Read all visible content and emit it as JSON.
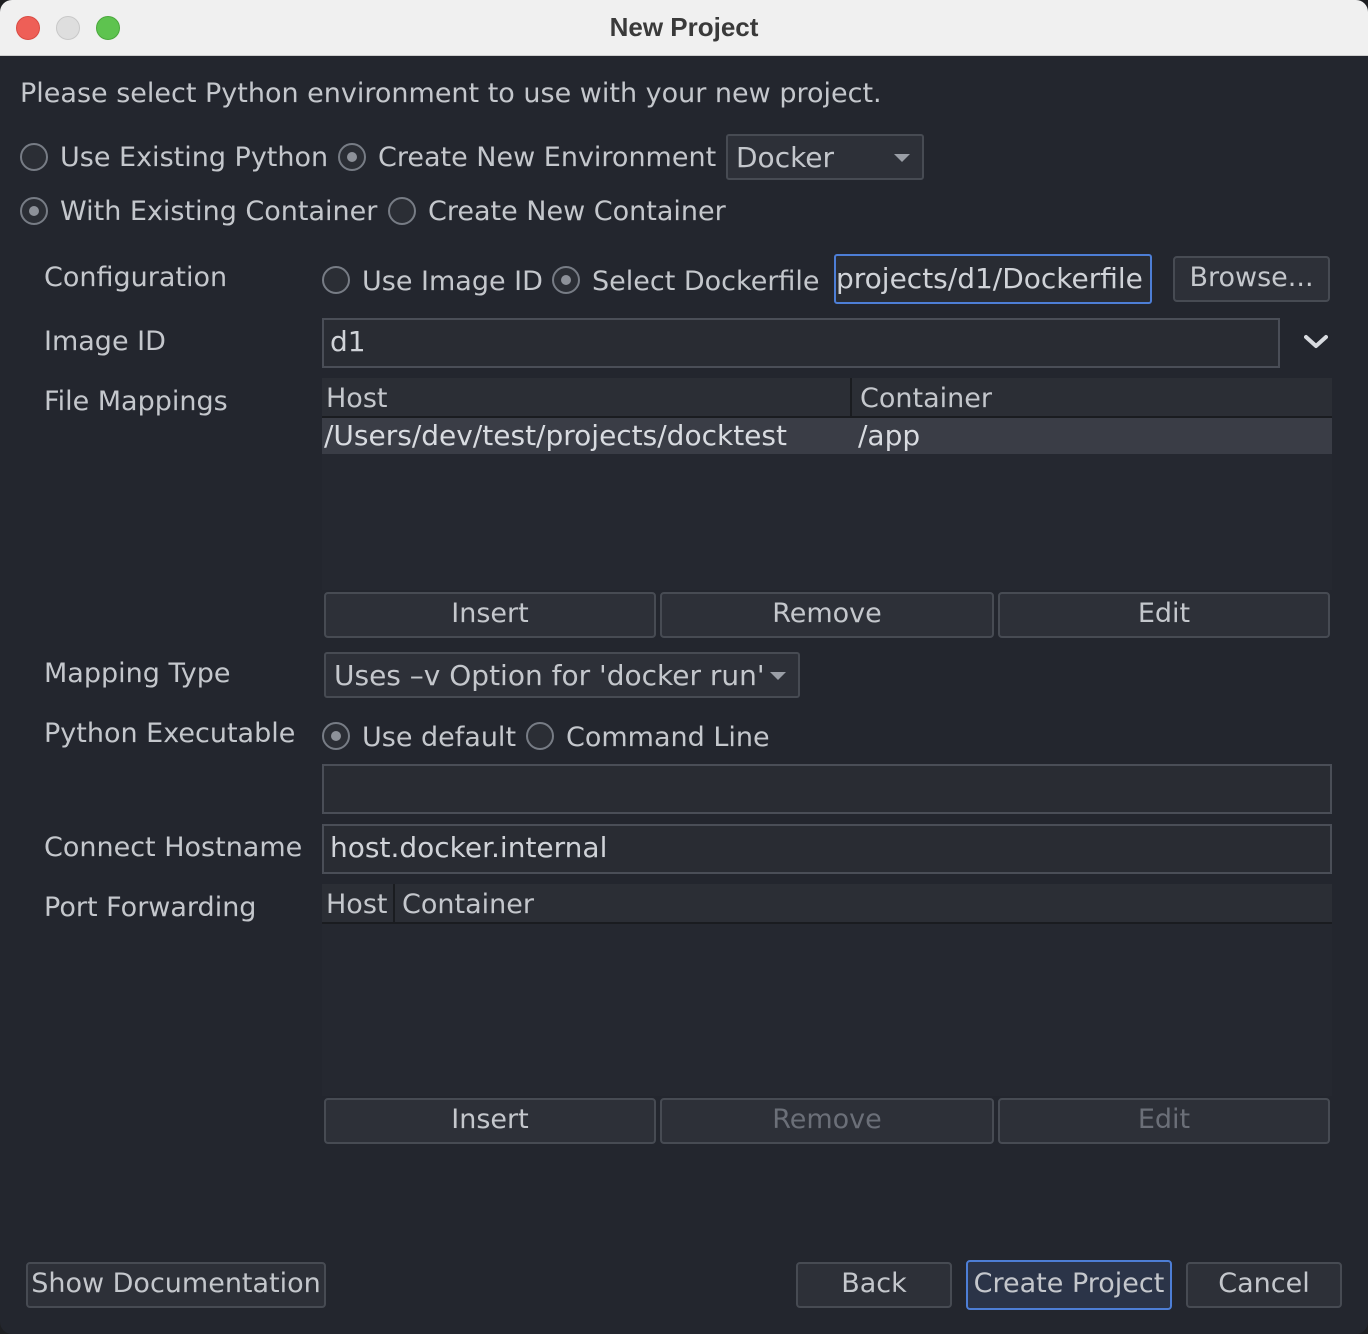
{
  "window": {
    "title": "New Project"
  },
  "intro": "Please select Python environment to use with your new project.",
  "env": {
    "use_existing": "Use Existing Python",
    "create_new": "Create New Environment",
    "type_value": "Docker"
  },
  "container": {
    "with_existing": "With Existing Container",
    "create_new": "Create New Container"
  },
  "configuration": {
    "label": "Configuration",
    "use_image_id": "Use Image ID",
    "select_dockerfile": "Select Dockerfile",
    "dockerfile_path": "projects/d1/Dockerfile",
    "browse": "Browse..."
  },
  "image_id": {
    "label": "Image ID",
    "value": "d1"
  },
  "file_mappings": {
    "label": "File Mappings",
    "columns": [
      "Host",
      "Container"
    ],
    "rows": [
      {
        "host": "/Users/dev/test/projects/docktest",
        "container": "/app"
      }
    ],
    "insert": "Insert",
    "remove": "Remove",
    "edit": "Edit"
  },
  "mapping_type": {
    "label": "Mapping Type",
    "value": "Uses –v Option for 'docker run'"
  },
  "python_exec": {
    "label": "Python Executable",
    "use_default": "Use default",
    "command_line": "Command Line",
    "command_value": ""
  },
  "hostname": {
    "label": "Connect Hostname",
    "value": "host.docker.internal"
  },
  "port_forwarding": {
    "label": "Port Forwarding",
    "columns": [
      "Host",
      "Container"
    ],
    "insert": "Insert",
    "remove": "Remove",
    "edit": "Edit"
  },
  "footer": {
    "show_docs": "Show Documentation",
    "back": "Back",
    "create": "Create Project",
    "cancel": "Cancel"
  },
  "colors": {
    "accent": "#4d7ed6",
    "background": "#23262e"
  }
}
